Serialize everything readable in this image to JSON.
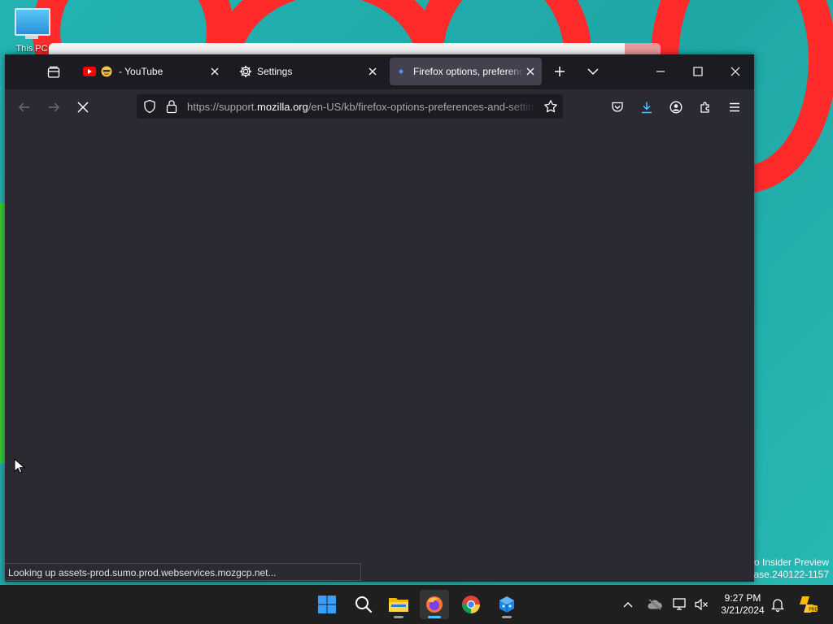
{
  "desktop": {
    "icon_label": "This PC",
    "watermark_line1": "ro Insider Preview",
    "watermark_line2": "ease.240122-1157"
  },
  "browser": {
    "tabs": [
      {
        "title": "- YouTube",
        "icon": "youtube-icon",
        "secondary_icon": "emoji-avatar-icon",
        "active": false
      },
      {
        "title": "Settings",
        "icon": "gear-icon",
        "active": false
      },
      {
        "title": "Firefox options, preferences and settings",
        "icon": "loading-dot-icon",
        "active": true
      }
    ],
    "url": {
      "prefix": "https://support.",
      "domain": "mozilla.org",
      "path": "/en-US/kb/firefox-options-preferences-and-settings"
    },
    "status_text": "Looking up assets-prod.sumo.prod.webservices.mozgcp.net..."
  },
  "taskbar": {
    "apps": [
      "windows-start",
      "search",
      "file-explorer",
      "firefox",
      "chrome",
      "app-cube"
    ],
    "clock": {
      "time": "9:27 PM",
      "date": "3/21/2024"
    }
  },
  "colors": {
    "accent": "#4cc2ff",
    "browser_bg": "#2b2a33",
    "tabbar_bg": "#1c1b22",
    "wallpaper_red": "#ff2a2a",
    "wallpaper_teal": "#1fa8a8"
  }
}
